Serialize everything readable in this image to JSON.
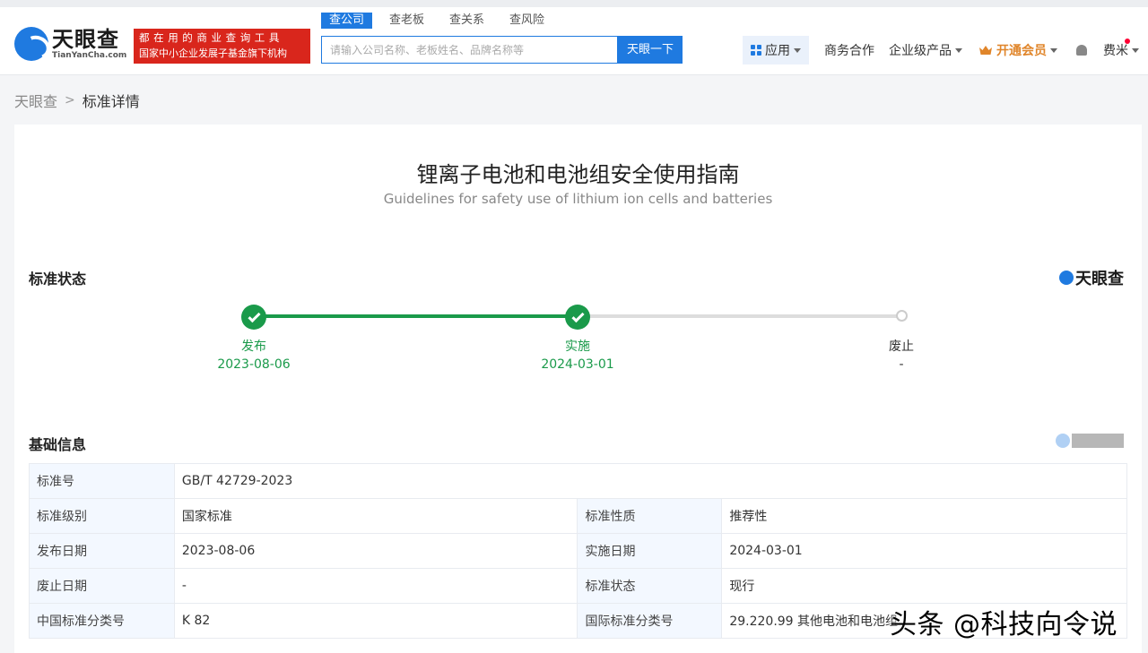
{
  "header": {
    "logo_cn": "天眼查",
    "logo_en": "TianYanCha.com",
    "slogan_line1": "都在用的商业查询工具",
    "slogan_line2": "国家中小企业发展子基金旗下机构",
    "search_tabs": [
      "查公司",
      "查老板",
      "查关系",
      "查风险"
    ],
    "search_placeholder": "请输入公司名称、老板姓名、品牌名称等",
    "search_button": "天眼一下",
    "nav_app": "应用",
    "nav_biz": "商务合作",
    "nav_ent": "企业级产品",
    "nav_vip": "开通会员",
    "nav_user": "费米"
  },
  "breadcrumb": {
    "home": "天眼查",
    "current": "标准详情"
  },
  "standard": {
    "title_cn": "锂离子电池和电池组安全使用指南",
    "title_en": "Guidelines for safety use of lithium ion cells and batteries"
  },
  "status_section": {
    "title": "标准状态",
    "brand": "天眼查",
    "steps": [
      {
        "label": "发布",
        "date": "2023-08-06",
        "done": true
      },
      {
        "label": "实施",
        "date": "2024-03-01",
        "done": true
      },
      {
        "label": "废止",
        "date": "-",
        "done": false
      }
    ],
    "colors": {
      "done": "#1a9a4a",
      "pending": "#dddddd"
    }
  },
  "basic_section": {
    "title": "基础信息",
    "rows": [
      {
        "k1": "标准号",
        "v1": "GB/T 42729-2023"
      },
      {
        "k1": "标准级别",
        "v1": "国家标准",
        "k2": "标准性质",
        "v2": "推荐性"
      },
      {
        "k1": "发布日期",
        "v1": "2023-08-06",
        "k2": "实施日期",
        "v2": "2024-03-01"
      },
      {
        "k1": "废止日期",
        "v1": "-",
        "k2": "标准状态",
        "v2": "现行"
      },
      {
        "k1": "中国标准分类号",
        "v1": "K 82",
        "k2": "国际标准分类号",
        "v2": "29.220.99 其他电池和电池组"
      }
    ]
  },
  "watermark": "头条 @科技向令说"
}
